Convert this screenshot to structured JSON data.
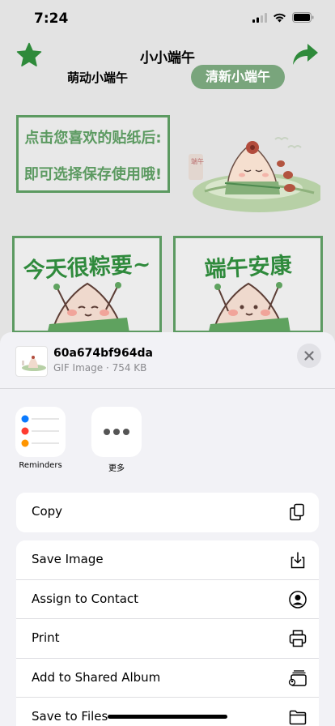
{
  "status_bar": {
    "time": "7:24",
    "icons": [
      "signal-icon",
      "wifi-icon",
      "battery-icon"
    ]
  },
  "header": {
    "title": "小小端午",
    "left_icon": "star-icon",
    "right_icon": "share-arrow-icon",
    "tabs": [
      {
        "label": "萌动小端午",
        "selected": false
      },
      {
        "label": "清新小端午",
        "selected": true
      }
    ]
  },
  "promo": {
    "line1": "点击您喜欢的贴纸后:",
    "line2": "即可选择保存使用哦!",
    "sign": "端午"
  },
  "stickers": [
    {
      "text": "今天很粽要~"
    },
    {
      "text": "端午安康"
    }
  ],
  "share_sheet": {
    "file": {
      "name": "60a674bf964da",
      "meta": "GIF Image · 754 KB"
    },
    "apps": [
      {
        "label": "Reminders",
        "icon": "reminders-icon"
      },
      {
        "label": "更多",
        "icon": "more-icon"
      }
    ],
    "actions_primary": [
      {
        "label": "Copy",
        "icon": "copy-icon"
      }
    ],
    "actions_secondary": [
      {
        "label": "Save Image",
        "icon": "save-image-icon"
      },
      {
        "label": "Assign to Contact",
        "icon": "contact-icon"
      },
      {
        "label": "Print",
        "icon": "printer-icon"
      },
      {
        "label": "Add to Shared Album",
        "icon": "shared-album-icon"
      },
      {
        "label": "Save to Files",
        "icon": "folder-icon"
      }
    ]
  },
  "colors": {
    "accent_green": "#5c9a61",
    "tab_green": "#79a57c",
    "sheet_bg": "#f2f2f6"
  }
}
